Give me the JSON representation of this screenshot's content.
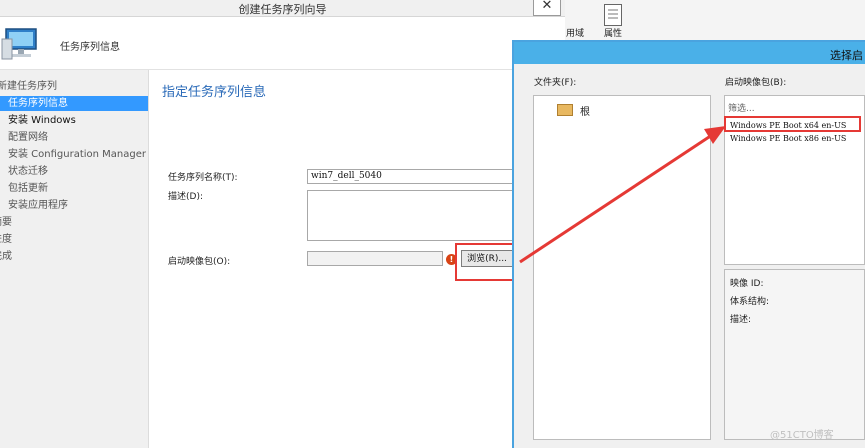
{
  "wizard": {
    "title": "创建任务序列向导",
    "close": "✕",
    "header_title": "任务序列信息",
    "nav": [
      {
        "label": "新建任务序列"
      },
      {
        "label": "任务序列信息"
      },
      {
        "label": "安装 Windows"
      },
      {
        "label": "配置网络"
      },
      {
        "label": "安装 Configuration Manager"
      },
      {
        "label": "状态迁移"
      },
      {
        "label": "包括更新"
      },
      {
        "label": "安装应用程序"
      },
      {
        "label": "摘要"
      },
      {
        "label": "进度"
      },
      {
        "label": "完成"
      }
    ],
    "content_title": "指定任务序列信息",
    "name_label": "任务序列名称(T):",
    "name_value": "win7_dell_5040",
    "desc_label": "描述(D):",
    "desc_value": "",
    "boot_label": "启动映像包(O):",
    "boot_value": "",
    "browse_label": "浏览(R)..."
  },
  "ribbon": {
    "domain_label": "用域",
    "properties_label": "属性"
  },
  "dialog": {
    "title": "选择启",
    "folder_label": "文件夹(F):",
    "folder_root": "根",
    "boot_label": "启动映像包(B):",
    "filter_placeholder": "筛选...",
    "packages": [
      {
        "name": "Windows PE Boot x64  en-US"
      },
      {
        "name": "Windows PE Boot x86  en-US"
      }
    ],
    "detail_labels": {
      "image_id": "映像 ID:",
      "architecture": "体系结构:",
      "description": "描述:"
    }
  },
  "watermark": "@51CTO博客",
  "colors": {
    "accent": "#3399ff",
    "highlight_box": "#e53935",
    "content_title": "#2a6ab8",
    "dialog_titlebar": "#4ab0e8"
  },
  "icons": [
    "computer-icon",
    "folder-icon",
    "properties-icon",
    "warning-icon",
    "close-icon"
  ]
}
